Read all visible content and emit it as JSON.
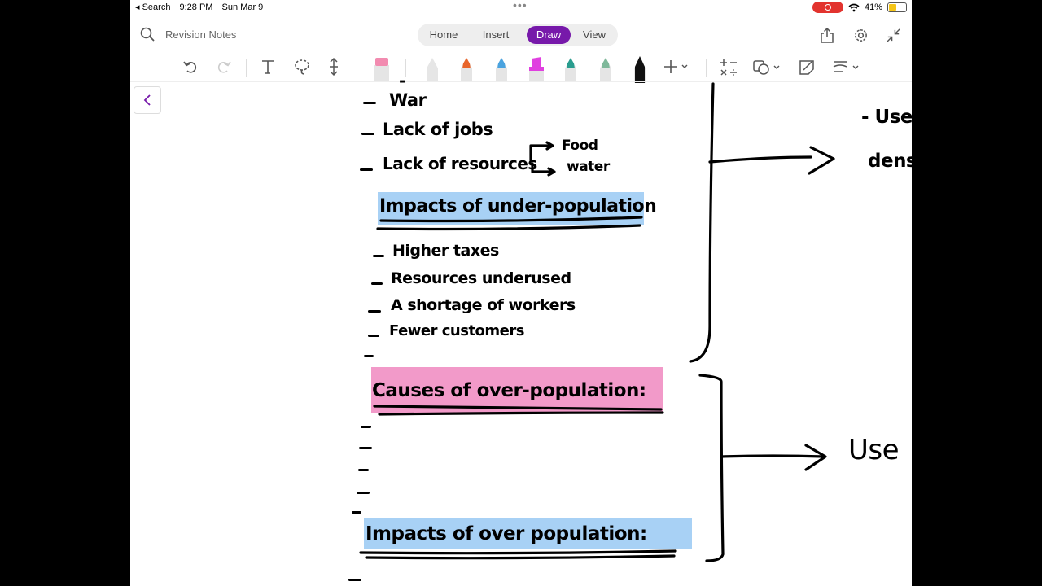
{
  "status_bar": {
    "back_label": "◂ Search",
    "time": "9:28 PM",
    "date": "Sun Mar 9",
    "battery": "41%",
    "battery_level": 0.41
  },
  "header": {
    "title": "Revision Notes",
    "tabs": [
      {
        "label": "Home",
        "active": false
      },
      {
        "label": "Insert",
        "active": false
      },
      {
        "label": "Draw",
        "active": true
      },
      {
        "label": "View",
        "active": false
      }
    ],
    "accent": "#7719aa"
  },
  "toolbar": {
    "tools": [
      "undo-icon",
      "redo-icon",
      "text-icon",
      "lasso-icon",
      "insert-space-icon"
    ],
    "pens": [
      {
        "name": "eraser",
        "color": "#f28bb0"
      },
      {
        "name": "pen-white",
        "color": "#e6e6e6"
      },
      {
        "name": "pen-orange",
        "color": "#e8652b"
      },
      {
        "name": "pen-blue",
        "color": "#4aa3df"
      },
      {
        "name": "highlighter-magenta",
        "color": "#e040e0"
      },
      {
        "name": "pen-teal",
        "color": "#2a9d8f"
      },
      {
        "name": "pen-green",
        "color": "#7fb89a"
      },
      {
        "name": "pen-black",
        "color": "#111111"
      }
    ]
  },
  "notes": {
    "partial_line": "-",
    "causes_under": [
      "War",
      "Lack of jobs",
      "Lack of resources"
    ],
    "branch_items": [
      "Food",
      "water"
    ],
    "heading_impacts_under": "Impacts of under-population",
    "impacts_under": [
      "Higher taxes",
      "Resources underused",
      "A shortage of workers",
      "Fewer customers"
    ],
    "heading_causes_over": "Causes of over-population:",
    "heading_impacts_over": "Impacts of over population:",
    "right_top": [
      "- Use",
      "dens"
    ],
    "right_bottom": "Use",
    "highlight_blue": "#a8d1f5",
    "highlight_pink": "#f29ac9"
  }
}
